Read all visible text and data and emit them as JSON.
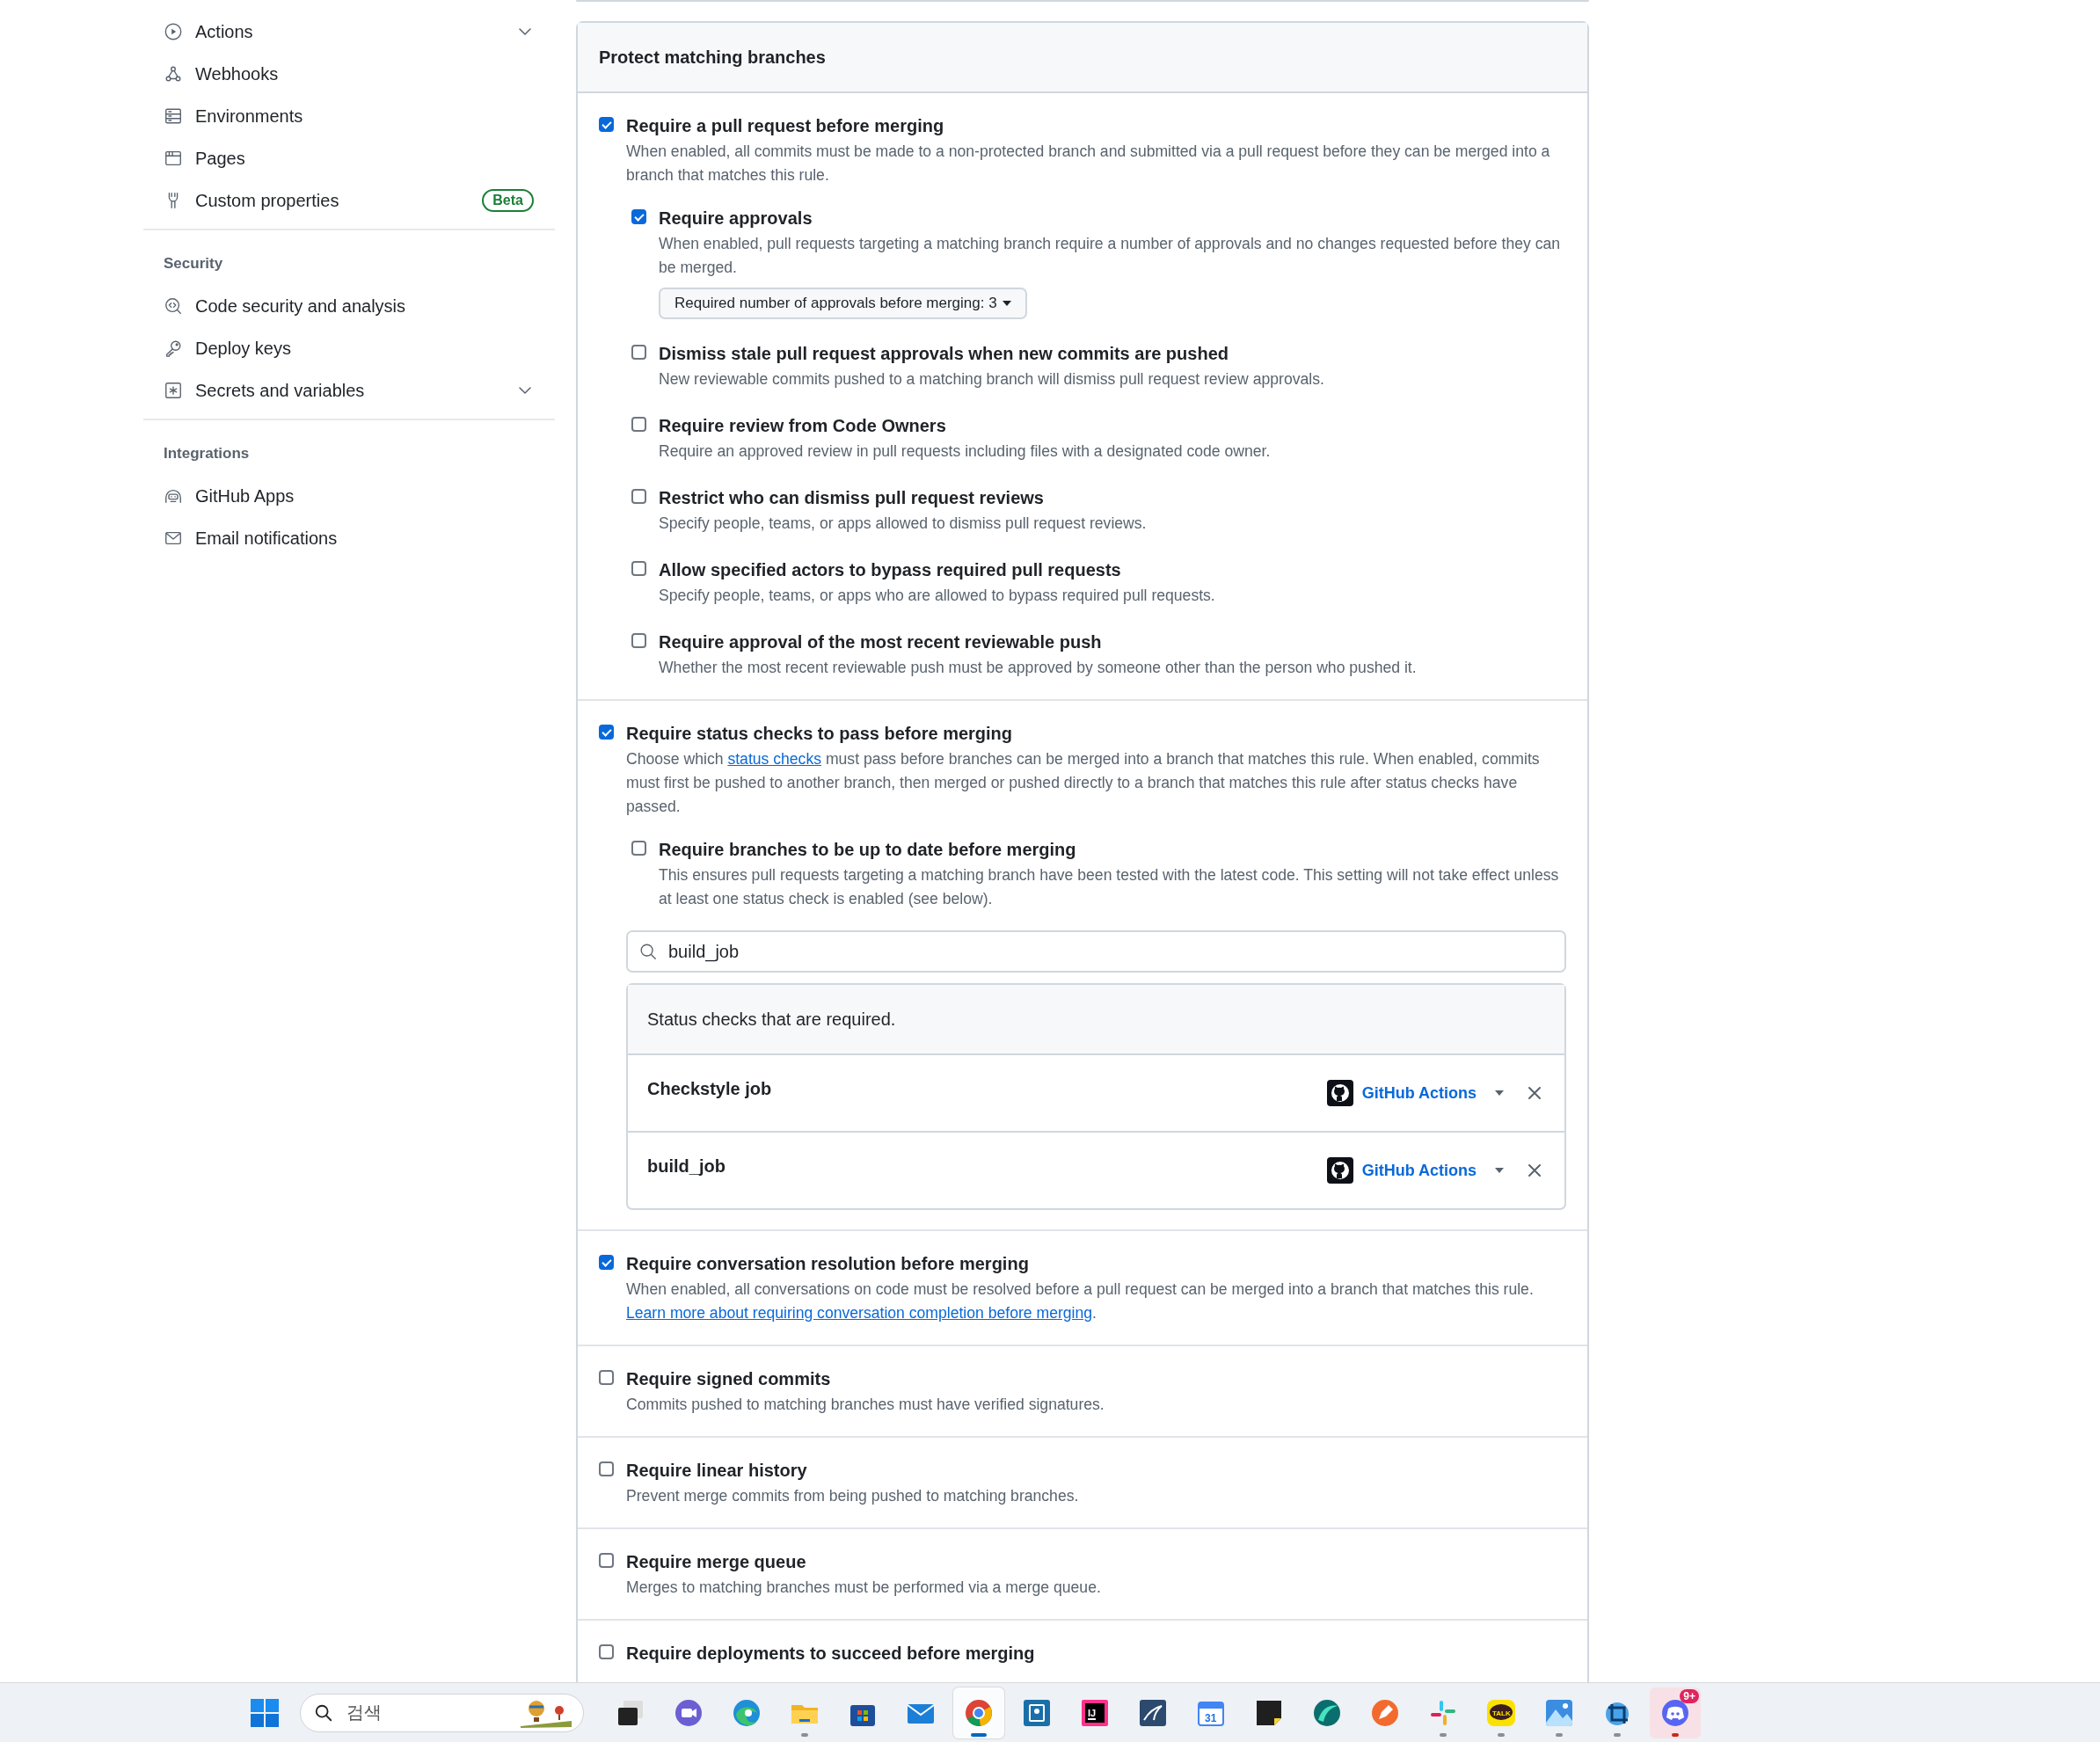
{
  "sidebar": {
    "groups": [
      {
        "items": [
          {
            "label": "Actions",
            "expandable": true
          },
          {
            "label": "Webhooks",
            "expandable": false
          },
          {
            "label": "Environments",
            "expandable": false
          },
          {
            "label": "Pages",
            "expandable": false
          },
          {
            "label": "Custom properties",
            "expandable": false,
            "badge": "Beta"
          }
        ]
      },
      {
        "heading": "Security",
        "items": [
          {
            "label": "Code security and analysis",
            "expandable": false
          },
          {
            "label": "Deploy keys",
            "expandable": false
          },
          {
            "label": "Secrets and variables",
            "expandable": true
          }
        ]
      },
      {
        "heading": "Integrations",
        "items": [
          {
            "label": "GitHub Apps",
            "expandable": false
          },
          {
            "label": "Email notifications",
            "expandable": false
          }
        ]
      }
    ]
  },
  "panel": {
    "title": "Protect matching branches",
    "sections": [
      {
        "title": "Require a pull request before merging",
        "checked": true,
        "description": "When enabled, all commits must be made to a non-protected branch and submitted via a pull request before they can be merged into a branch that matches this rule.",
        "children": [
          {
            "title": "Require approvals",
            "checked": true,
            "description": "When enabled, pull requests targeting a matching branch require a number of approvals and no changes requested before they can be merged.",
            "dropdown": "Required number of approvals before merging: 3"
          },
          {
            "title": "Dismiss stale pull request approvals when new commits are pushed",
            "checked": false,
            "description": "New reviewable commits pushed to a matching branch will dismiss pull request review approvals."
          },
          {
            "title": "Require review from Code Owners",
            "checked": false,
            "description": "Require an approved review in pull requests including files with a designated code owner."
          },
          {
            "title": "Restrict who can dismiss pull request reviews",
            "checked": false,
            "description": "Specify people, teams, or apps allowed to dismiss pull request reviews."
          },
          {
            "title": "Allow specified actors to bypass required pull requests",
            "checked": false,
            "description": "Specify people, teams, or apps who are allowed to bypass required pull requests."
          },
          {
            "title": "Require approval of the most recent reviewable push",
            "checked": false,
            "description": "Whether the most recent reviewable push must be approved by someone other than the person who pushed it."
          }
        ]
      },
      {
        "title": "Require status checks to pass before merging",
        "checked": true,
        "description_parts": [
          {
            "kind": "text",
            "text": "Choose which "
          },
          {
            "kind": "link",
            "text": "status checks"
          },
          {
            "kind": "text",
            "text": " must pass before branches can be merged into a branch that matches this rule. When enabled, commits must first be pushed to another branch, then merged or pushed directly to a branch that matches this rule after status checks have passed."
          }
        ],
        "children": [
          {
            "title": "Require branches to be up to date before merging",
            "checked": false,
            "description": "This ensures pull requests targeting a matching branch have been tested with the latest code. This setting will not take effect unless at least one status check is enabled (see below)."
          }
        ],
        "search": {
          "value": "build_job"
        },
        "required_checks": {
          "heading": "Status checks that are required.",
          "rows": [
            {
              "name": "Checkstyle job",
              "app": "GitHub Actions"
            },
            {
              "name": "build_job",
              "app": "GitHub Actions"
            }
          ]
        }
      },
      {
        "title": "Require conversation resolution before merging",
        "checked": true,
        "description_parts": [
          {
            "kind": "text",
            "text": "When enabled, all conversations on code must be resolved before a pull request can be merged into a branch that matches this rule. "
          },
          {
            "kind": "link",
            "text": "Learn more about requiring conversation completion before merging"
          },
          {
            "kind": "text",
            "text": "."
          }
        ]
      },
      {
        "title": "Require signed commits",
        "checked": false,
        "description": "Commits pushed to matching branches must have verified signatures."
      },
      {
        "title": "Require linear history",
        "checked": false,
        "description": "Prevent merge commits from being pushed to matching branches."
      },
      {
        "title": "Require merge queue",
        "checked": false,
        "description": "Merges to matching branches must be performed via a merge queue."
      },
      {
        "title": "Require deployments to succeed before merging",
        "checked": false
      }
    ]
  },
  "taskbar": {
    "search": {
      "placeholder": "검색"
    },
    "apps": [
      {
        "kind": "taskview",
        "running": false,
        "selected": false,
        "attention": false
      },
      {
        "kind": "meet",
        "running": false,
        "selected": false,
        "attention": false
      },
      {
        "kind": "edge",
        "running": false,
        "selected": false,
        "attention": false
      },
      {
        "kind": "files",
        "running": true,
        "selected": false,
        "attention": false
      },
      {
        "kind": "store",
        "running": false,
        "selected": false,
        "attention": false
      },
      {
        "kind": "mail",
        "running": false,
        "selected": false,
        "attention": false
      },
      {
        "kind": "chrome",
        "running": true,
        "selected": true,
        "attention": false
      },
      {
        "kind": "hangul",
        "running": false,
        "selected": false,
        "attention": false
      },
      {
        "kind": "intellij",
        "running": false,
        "selected": false,
        "attention": false,
        "label": "IJ"
      },
      {
        "kind": "mysql",
        "running": false,
        "selected": false,
        "attention": false
      },
      {
        "kind": "calendar",
        "running": false,
        "selected": false,
        "attention": false,
        "label": "31"
      },
      {
        "kind": "sticky",
        "running": false,
        "selected": false,
        "attention": false
      },
      {
        "kind": "teal",
        "running": false,
        "selected": false,
        "attention": false
      },
      {
        "kind": "pen",
        "running": false,
        "selected": false,
        "attention": false
      },
      {
        "kind": "slack",
        "running": true,
        "selected": false,
        "attention": false
      },
      {
        "kind": "kakaotalk",
        "running": true,
        "selected": false,
        "attention": false,
        "label": "TALK"
      },
      {
        "kind": "photos",
        "running": true,
        "selected": false,
        "attention": false
      },
      {
        "kind": "capture",
        "running": true,
        "selected": false,
        "attention": false
      },
      {
        "kind": "discord",
        "running": true,
        "selected": false,
        "attention": true,
        "badge": "9+"
      }
    ]
  }
}
